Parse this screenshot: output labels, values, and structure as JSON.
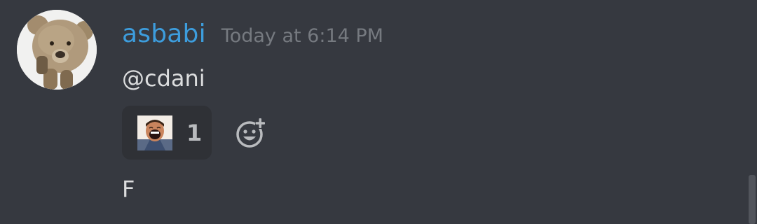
{
  "message": {
    "author": "asbabi",
    "timestamp": "Today at 6:14 PM",
    "content": "@cdani",
    "followup": "F"
  },
  "reactions": [
    {
      "emoji": "laughing-man-emoji",
      "count": "1"
    }
  ],
  "colors": {
    "background": "#363940",
    "username": "#3d9ddd",
    "timestamp": "#767a80",
    "text": "#dcddde",
    "reaction_bg": "#2f3136"
  }
}
